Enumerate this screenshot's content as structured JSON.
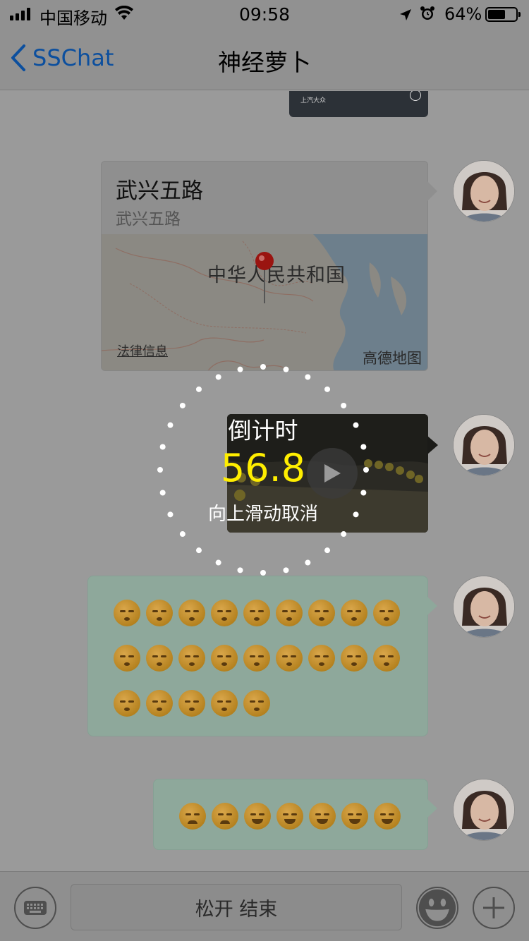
{
  "status_bar": {
    "carrier": "中国移动",
    "time": "09:58",
    "battery_percent": "64%",
    "battery_level": 0.64,
    "icons": [
      "signal-icon",
      "wifi-icon",
      "location-arrow-icon",
      "alarm-icon",
      "battery-icon"
    ]
  },
  "nav": {
    "back_label": "SSChat",
    "title": "神经萝卜"
  },
  "messages": {
    "partial_card": {
      "brand_text": "上汽大众"
    },
    "location": {
      "name": "武兴五路",
      "address": "武兴五路",
      "map_country_label": "中华人民共和国",
      "map_legal_link": "法律信息",
      "map_provider": "高德地图"
    },
    "video": {
      "play_icon": "play-icon"
    },
    "emoji_bubble_1": {
      "emoji_count": 23,
      "emoji_name": "sleepy-face-emoji"
    },
    "emoji_bubble_2": {
      "emojis": [
        "worried-face-emoji",
        "worried-face-emoji",
        "smiling-face-emoji",
        "smiling-face-emoji",
        "smiling-face-emoji",
        "smiling-face-emoji",
        "smiling-face-emoji"
      ]
    }
  },
  "recording_overlay": {
    "label": "倒计时",
    "countdown": "56.8",
    "hint": "向上滑动取消",
    "countdown_color": "#ffee00"
  },
  "input_bar": {
    "hold_button_label": "松开 结束",
    "icons": [
      "keyboard-icon",
      "emoji-face-icon",
      "plus-icon"
    ]
  },
  "colors": {
    "accent": "#0c4f9e",
    "bubble_self": "#8ea89b"
  }
}
